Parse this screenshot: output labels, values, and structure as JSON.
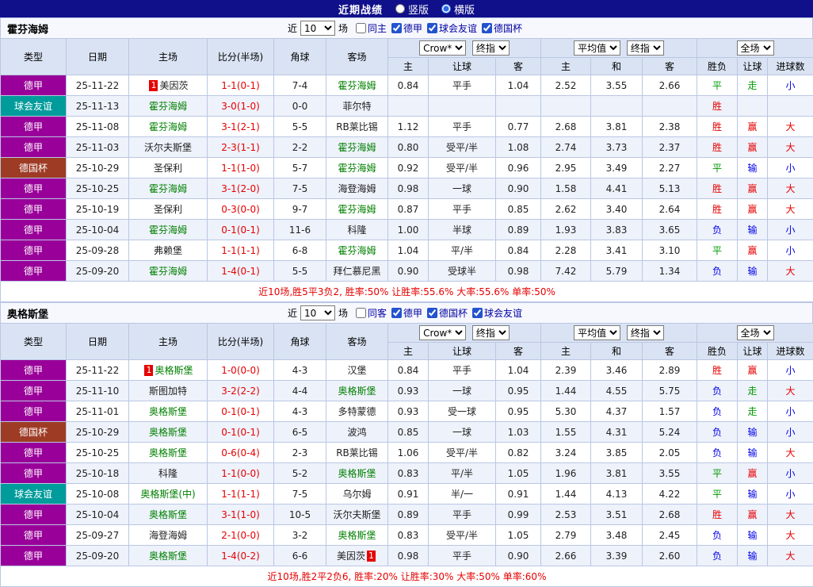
{
  "top_bar": {
    "title": "近期战绩",
    "radio_options": [
      {
        "label": "竖版",
        "selected": false
      },
      {
        "label": "横版",
        "selected": true
      }
    ]
  },
  "table": {
    "columns": [
      "类型",
      "日期",
      "主场",
      "比分(半场)",
      "角球",
      "客场"
    ],
    "sub_columns": [
      "主",
      "让球",
      "客",
      "主",
      "和",
      "客",
      "胜负",
      "让球",
      "进球数"
    ],
    "dropdowns": {
      "asia_source": "Crow*",
      "asia_time": "终指",
      "eu_source": "平均值",
      "eu_time": "终指",
      "scope": "全场"
    }
  },
  "colors": {
    "league_purple": "#990099",
    "friendly_teal": "#009b9b",
    "cup_red": "#9e3b25",
    "focus_team_green": "#008000",
    "win_red": "#e60000",
    "lose_blue": "#0000e6",
    "draw_green": "#009900"
  },
  "sections": [
    {
      "team": "霍芬海姆",
      "filter": {
        "near_label": "近",
        "count": "10",
        "games_label": "场",
        "checkboxes": [
          {
            "label": "同主",
            "checked": false
          },
          {
            "label": "德甲",
            "checked": true
          },
          {
            "label": "球会友谊",
            "checked": true
          },
          {
            "label": "德国杯",
            "checked": true
          }
        ]
      },
      "rows": [
        {
          "type": "德甲",
          "type_key": "league",
          "date": "25-11-22",
          "home": {
            "name": "美因茨",
            "badge": "1",
            "badge_pos": "left"
          },
          "score": "1-1(0-1)",
          "corners": "7-4",
          "away": {
            "name": "霍芬海姆",
            "focus": true
          },
          "odds": [
            "0.84",
            "平手",
            "1.04",
            "2.52",
            "3.55",
            "2.66"
          ],
          "results": [
            [
              "平",
              "g"
            ],
            [
              "走",
              "g"
            ],
            [
              "小",
              "b"
            ]
          ]
        },
        {
          "type": "球会友谊",
          "type_key": "friendly",
          "date": "25-11-13",
          "home": {
            "name": "霍芬海姆",
            "focus": true
          },
          "score": "3-0(1-0)",
          "corners": "0-0",
          "away": {
            "name": "菲尔特"
          },
          "odds": [
            "",
            "",
            "",
            "",
            "",
            ""
          ],
          "results": [
            [
              "胜",
              "r"
            ],
            [
              "",
              ""
            ],
            [
              "",
              ""
            ]
          ]
        },
        {
          "type": "德甲",
          "type_key": "league",
          "date": "25-11-08",
          "home": {
            "name": "霍芬海姆",
            "focus": true
          },
          "score": "3-1(2-1)",
          "corners": "5-5",
          "away": {
            "name": "RB莱比锡"
          },
          "odds": [
            "1.12",
            "平手",
            "0.77",
            "2.68",
            "3.81",
            "2.38"
          ],
          "results": [
            [
              "胜",
              "r"
            ],
            [
              "赢",
              "r"
            ],
            [
              "大",
              "r"
            ]
          ]
        },
        {
          "type": "德甲",
          "type_key": "league",
          "date": "25-11-03",
          "home": {
            "name": "沃尔夫斯堡"
          },
          "score": "2-3(1-1)",
          "corners": "2-2",
          "away": {
            "name": "霍芬海姆",
            "focus": true
          },
          "odds": [
            "0.80",
            "受平/半",
            "1.08",
            "2.74",
            "3.73",
            "2.37"
          ],
          "results": [
            [
              "胜",
              "r"
            ],
            [
              "赢",
              "r"
            ],
            [
              "大",
              "r"
            ]
          ]
        },
        {
          "type": "德国杯",
          "type_key": "cup",
          "date": "25-10-29",
          "home": {
            "name": "圣保利"
          },
          "score": "1-1(1-0)",
          "corners": "5-7",
          "away": {
            "name": "霍芬海姆",
            "focus": true
          },
          "odds": [
            "0.92",
            "受平/半",
            "0.96",
            "2.95",
            "3.49",
            "2.27"
          ],
          "results": [
            [
              "平",
              "g"
            ],
            [
              "输",
              "b"
            ],
            [
              "小",
              "b"
            ]
          ]
        },
        {
          "type": "德甲",
          "type_key": "league",
          "date": "25-10-25",
          "home": {
            "name": "霍芬海姆",
            "focus": true
          },
          "score": "3-1(2-0)",
          "corners": "7-5",
          "away": {
            "name": "海登海姆"
          },
          "odds": [
            "0.98",
            "一球",
            "0.90",
            "1.58",
            "4.41",
            "5.13"
          ],
          "results": [
            [
              "胜",
              "r"
            ],
            [
              "赢",
              "r"
            ],
            [
              "大",
              "r"
            ]
          ]
        },
        {
          "type": "德甲",
          "type_key": "league",
          "date": "25-10-19",
          "home": {
            "name": "圣保利"
          },
          "score": "0-3(0-0)",
          "corners": "9-7",
          "away": {
            "name": "霍芬海姆",
            "focus": true
          },
          "odds": [
            "0.87",
            "平手",
            "0.85",
            "2.62",
            "3.40",
            "2.64"
          ],
          "results": [
            [
              "胜",
              "r"
            ],
            [
              "赢",
              "r"
            ],
            [
              "大",
              "r"
            ]
          ]
        },
        {
          "type": "德甲",
          "type_key": "league",
          "date": "25-10-04",
          "home": {
            "name": "霍芬海姆",
            "focus": true
          },
          "score": "0-1(0-1)",
          "corners": "11-6",
          "away": {
            "name": "科隆"
          },
          "odds": [
            "1.00",
            "半球",
            "0.89",
            "1.93",
            "3.83",
            "3.65"
          ],
          "results": [
            [
              "负",
              "b"
            ],
            [
              "输",
              "b"
            ],
            [
              "小",
              "b"
            ]
          ]
        },
        {
          "type": "德甲",
          "type_key": "league",
          "date": "25-09-28",
          "home": {
            "name": "弗赖堡"
          },
          "score": "1-1(1-1)",
          "corners": "6-8",
          "away": {
            "name": "霍芬海姆",
            "focus": true
          },
          "odds": [
            "1.04",
            "平/半",
            "0.84",
            "2.28",
            "3.41",
            "3.10"
          ],
          "results": [
            [
              "平",
              "g"
            ],
            [
              "赢",
              "r"
            ],
            [
              "小",
              "b"
            ]
          ]
        },
        {
          "type": "德甲",
          "type_key": "league",
          "date": "25-09-20",
          "home": {
            "name": "霍芬海姆",
            "focus": true
          },
          "score": "1-4(0-1)",
          "corners": "5-5",
          "away": {
            "name": "拜仁慕尼黑"
          },
          "odds": [
            "0.90",
            "受球半",
            "0.98",
            "7.42",
            "5.79",
            "1.34"
          ],
          "results": [
            [
              "负",
              "b"
            ],
            [
              "输",
              "b"
            ],
            [
              "大",
              "r"
            ]
          ]
        }
      ],
      "summary": "近10场,胜5平3负2, 胜率:50% 让胜率:55.6% 大率:55.6% 单率:50%"
    },
    {
      "team": "奥格斯堡",
      "filter": {
        "near_label": "近",
        "count": "10",
        "games_label": "场",
        "checkboxes": [
          {
            "label": "同客",
            "checked": false
          },
          {
            "label": "德甲",
            "checked": true
          },
          {
            "label": "德国杯",
            "checked": true
          },
          {
            "label": "球会友谊",
            "checked": true
          }
        ]
      },
      "rows": [
        {
          "type": "德甲",
          "type_key": "league",
          "date": "25-11-22",
          "home": {
            "name": "奥格斯堡",
            "focus": true,
            "badge": "1",
            "badge_pos": "left"
          },
          "score": "1-0(0-0)",
          "corners": "4-3",
          "away": {
            "name": "汉堡"
          },
          "odds": [
            "0.84",
            "平手",
            "1.04",
            "2.39",
            "3.46",
            "2.89"
          ],
          "results": [
            [
              "胜",
              "r"
            ],
            [
              "赢",
              "r"
            ],
            [
              "小",
              "b"
            ]
          ]
        },
        {
          "type": "德甲",
          "type_key": "league",
          "date": "25-11-10",
          "home": {
            "name": "斯图加特"
          },
          "score": "3-2(2-2)",
          "corners": "4-4",
          "away": {
            "name": "奥格斯堡",
            "focus": true
          },
          "odds": [
            "0.93",
            "一球",
            "0.95",
            "1.44",
            "4.55",
            "5.75"
          ],
          "results": [
            [
              "负",
              "b"
            ],
            [
              "走",
              "g"
            ],
            [
              "大",
              "r"
            ]
          ]
        },
        {
          "type": "德甲",
          "type_key": "league",
          "date": "25-11-01",
          "home": {
            "name": "奥格斯堡",
            "focus": true
          },
          "score": "0-1(0-1)",
          "corners": "4-3",
          "away": {
            "name": "多特蒙德"
          },
          "odds": [
            "0.93",
            "受一球",
            "0.95",
            "5.30",
            "4.37",
            "1.57"
          ],
          "results": [
            [
              "负",
              "b"
            ],
            [
              "走",
              "g"
            ],
            [
              "小",
              "b"
            ]
          ]
        },
        {
          "type": "德国杯",
          "type_key": "cup",
          "date": "25-10-29",
          "home": {
            "name": "奥格斯堡",
            "focus": true
          },
          "score": "0-1(0-1)",
          "corners": "6-5",
          "away": {
            "name": "波鸿"
          },
          "odds": [
            "0.85",
            "一球",
            "1.03",
            "1.55",
            "4.31",
            "5.24"
          ],
          "results": [
            [
              "负",
              "b"
            ],
            [
              "输",
              "b"
            ],
            [
              "小",
              "b"
            ]
          ]
        },
        {
          "type": "德甲",
          "type_key": "league",
          "date": "25-10-25",
          "home": {
            "name": "奥格斯堡",
            "focus": true
          },
          "score": "0-6(0-4)",
          "corners": "2-3",
          "away": {
            "name": "RB莱比锡"
          },
          "odds": [
            "1.06",
            "受平/半",
            "0.82",
            "3.24",
            "3.85",
            "2.05"
          ],
          "results": [
            [
              "负",
              "b"
            ],
            [
              "输",
              "b"
            ],
            [
              "大",
              "r"
            ]
          ]
        },
        {
          "type": "德甲",
          "type_key": "league",
          "date": "25-10-18",
          "home": {
            "name": "科隆"
          },
          "score": "1-1(0-0)",
          "corners": "5-2",
          "away": {
            "name": "奥格斯堡",
            "focus": true
          },
          "odds": [
            "0.83",
            "平/半",
            "1.05",
            "1.96",
            "3.81",
            "3.55"
          ],
          "results": [
            [
              "平",
              "g"
            ],
            [
              "赢",
              "r"
            ],
            [
              "小",
              "b"
            ]
          ]
        },
        {
          "type": "球会友谊",
          "type_key": "friendly",
          "date": "25-10-08",
          "home": {
            "name": "奥格斯堡(中)",
            "focus": true
          },
          "score": "1-1(1-1)",
          "corners": "7-5",
          "away": {
            "name": "乌尔姆"
          },
          "odds": [
            "0.91",
            "半/一",
            "0.91",
            "1.44",
            "4.13",
            "4.22"
          ],
          "results": [
            [
              "平",
              "g"
            ],
            [
              "输",
              "b"
            ],
            [
              "小",
              "b"
            ]
          ]
        },
        {
          "type": "德甲",
          "type_key": "league",
          "date": "25-10-04",
          "home": {
            "name": "奥格斯堡",
            "focus": true
          },
          "score": "3-1(1-0)",
          "corners": "10-5",
          "away": {
            "name": "沃尔夫斯堡"
          },
          "odds": [
            "0.89",
            "平手",
            "0.99",
            "2.53",
            "3.51",
            "2.68"
          ],
          "results": [
            [
              "胜",
              "r"
            ],
            [
              "赢",
              "r"
            ],
            [
              "大",
              "r"
            ]
          ]
        },
        {
          "type": "德甲",
          "type_key": "league",
          "date": "25-09-27",
          "home": {
            "name": "海登海姆"
          },
          "score": "2-1(0-0)",
          "corners": "3-2",
          "away": {
            "name": "奥格斯堡",
            "focus": true
          },
          "odds": [
            "0.83",
            "受平/半",
            "1.05",
            "2.79",
            "3.48",
            "2.45"
          ],
          "results": [
            [
              "负",
              "b"
            ],
            [
              "输",
              "b"
            ],
            [
              "大",
              "r"
            ]
          ]
        },
        {
          "type": "德甲",
          "type_key": "league",
          "date": "25-09-20",
          "home": {
            "name": "奥格斯堡",
            "focus": true
          },
          "score": "1-4(0-2)",
          "corners": "6-6",
          "away": {
            "name": "美因茨",
            "badge": "1",
            "badge_pos": "right"
          },
          "odds": [
            "0.98",
            "平手",
            "0.90",
            "2.66",
            "3.39",
            "2.60"
          ],
          "results": [
            [
              "负",
              "b"
            ],
            [
              "输",
              "b"
            ],
            [
              "大",
              "r"
            ]
          ]
        }
      ],
      "summary": "近10场,胜2平2负6, 胜率:20% 让胜率:30% 大率:50% 单率:60%"
    }
  ]
}
